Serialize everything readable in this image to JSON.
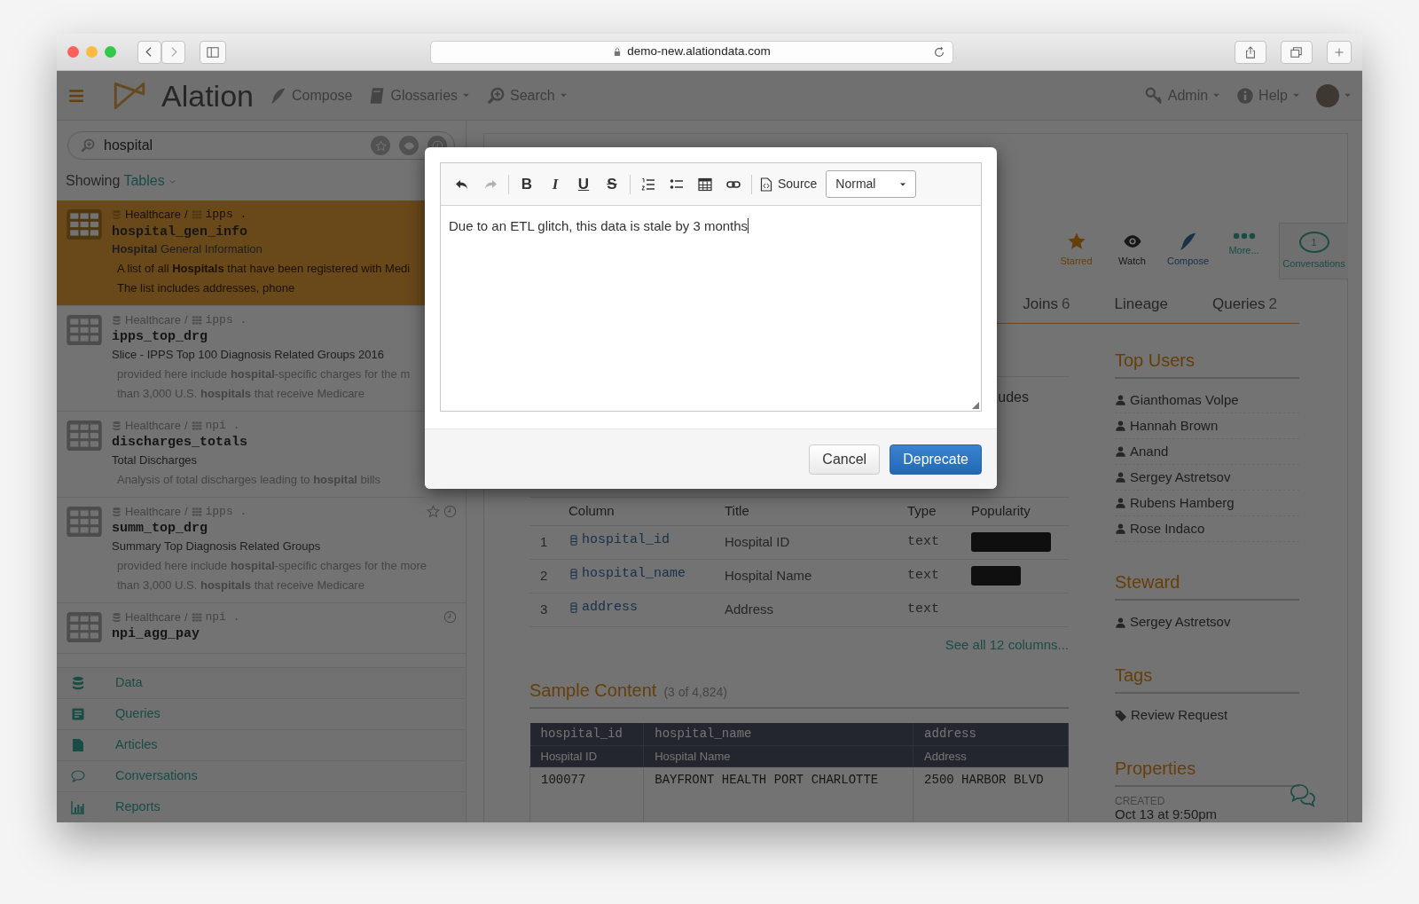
{
  "browser": {
    "url": "demo-new.alationdata.com"
  },
  "navbar": {
    "logo": "Alation",
    "items": [
      {
        "kind": "compose",
        "label": "Compose",
        "dropdown": false
      },
      {
        "kind": "glossaries",
        "label": "Glossaries",
        "dropdown": true
      },
      {
        "kind": "search",
        "label": "Search",
        "dropdown": true
      }
    ],
    "right_items": [
      {
        "kind": "admin",
        "label": "Admin",
        "dropdown": true
      },
      {
        "kind": "help",
        "label": "Help",
        "dropdown": true
      },
      {
        "kind": "avatar",
        "dropdown": true
      }
    ]
  },
  "sidebar": {
    "search": {
      "value": "hospital"
    },
    "filter_prefix": "Showing",
    "filter_value": "Tables",
    "results": [
      {
        "selected": true,
        "database": "Healthcare",
        "separator": "/",
        "schema": "ipps .",
        "name": "hospital_gen_info",
        "title": "**Hospital** General Information",
        "lines": [
          "A list of all **Hospitals** that have been registered with Medi",
          "The list includes addresses, phone"
        ],
        "star": false,
        "recent": false
      },
      {
        "selected": false,
        "database": "Healthcare",
        "separator": "/",
        "schema": "ipps .",
        "name": "ipps_top_drg",
        "title": "Slice - IPPS Top 100 Diagnosis Related Groups 2016",
        "lines": [
          "provided here include **hospital**-specific charges for the m",
          "than 3,000 U.S. **hospitals** that receive Medicare"
        ],
        "star": false,
        "recent": false
      },
      {
        "selected": false,
        "database": "Healthcare",
        "separator": "/",
        "schema": "npi .",
        "name": "discharges_totals",
        "title": "Total Discharges",
        "lines": [
          "Analysis of total discharges leading to **hospital** bills"
        ],
        "star": false,
        "recent": false
      },
      {
        "selected": false,
        "database": "Healthcare",
        "separator": "/",
        "schema": "ipps .",
        "name": "summ_top_drg",
        "title": "Summary Top Diagnosis Related Groups",
        "lines": [
          "provided here include **hospital**-specific charges for the more",
          "than 3,000 U.S. **hospitals** that receive Medicare"
        ],
        "star": true,
        "recent": true
      },
      {
        "selected": false,
        "database": "Healthcare",
        "separator": "/",
        "schema": "npi .",
        "name": "npi_agg_pay",
        "star": false,
        "recent": true
      }
    ],
    "nav": [
      {
        "kind": "data",
        "label": "Data"
      },
      {
        "kind": "queries",
        "label": "Queries"
      },
      {
        "kind": "articles",
        "label": "Articles"
      },
      {
        "kind": "conversations",
        "label": "Conversations"
      },
      {
        "kind": "reports",
        "label": "Reports"
      }
    ]
  },
  "actions": [
    {
      "kind": "star",
      "label": "Starred",
      "on": true
    },
    {
      "kind": "watch",
      "label": "Watch",
      "on": false
    },
    {
      "kind": "compose",
      "label": "Compose"
    },
    {
      "kind": "more",
      "label": "More..."
    }
  ],
  "conversations": {
    "label": "Conversations",
    "count": "1"
  },
  "tabs": [
    {
      "label": "Joins",
      "count": "6",
      "selected": false
    },
    {
      "label": "Lineage",
      "selected": false
    },
    {
      "label": "Queries",
      "count": "2",
      "selected": false
    }
  ],
  "description_tail": "udes",
  "columns_table": {
    "headers": [
      "Column",
      "Title",
      "Type",
      "Popularity"
    ],
    "rows": [
      {
        "number": "1",
        "name": "hospital_id",
        "title": "Hospital ID",
        "type": "text",
        "level": 0.82
      },
      {
        "number": "2",
        "name": "hospital_name",
        "title": "Hospital Name",
        "type": "text",
        "level": 0.51
      },
      {
        "number": "3",
        "name": "address",
        "title": "Address",
        "type": "text"
      }
    ],
    "see_all": "See all 12 columns..."
  },
  "sample": {
    "title": "Sample Content",
    "count": "(3 of 4,824)",
    "columns": [
      {
        "name": "hospital_id",
        "title": "Hospital ID"
      },
      {
        "name": "hospital_name",
        "title": "Hospital Name"
      },
      {
        "name": "address",
        "title": "Address"
      }
    ],
    "rows": [
      [
        "100077",
        "BAYFRONT HEALTH PORT CHARLOTTE",
        "2500 HARBOR BLVD"
      ]
    ]
  },
  "right_panel": {
    "sections": [
      {
        "title": "Top Users",
        "kind": "users",
        "items": [
          "Gianthomas Volpe",
          "Hannah Brown",
          "Anand",
          "Sergey Astretsov",
          "Rubens Hamberg",
          "Rose Indaco"
        ]
      },
      {
        "title": "Steward",
        "kind": "users",
        "items": [
          "Sergey Astretsov"
        ]
      },
      {
        "title": "Tags",
        "kind": "tags",
        "items": [
          "Review Request"
        ]
      },
      {
        "title": "Properties",
        "kind": "properties",
        "items": [
          {
            "label": "CREATED",
            "value": "Oct 13 at 9:50pm"
          }
        ]
      }
    ]
  },
  "modal": {
    "toolbar_groups": [
      [
        {
          "kind": "undo",
          "disabled": false
        },
        {
          "kind": "redo",
          "disabled": true
        }
      ],
      [
        {
          "kind": "bold",
          "label": "B",
          "disabled": false
        },
        {
          "kind": "italic",
          "label": "I",
          "disabled": false
        },
        {
          "kind": "underline",
          "label": "U",
          "disabled": false
        },
        {
          "kind": "strike",
          "label": "S",
          "disabled": false
        }
      ],
      [
        {
          "kind": "ordered-list",
          "disabled": false
        },
        {
          "kind": "bullet-list",
          "disabled": false
        },
        {
          "kind": "table",
          "disabled": false
        },
        {
          "kind": "link",
          "disabled": false
        }
      ],
      [
        {
          "kind": "source",
          "label": "Source",
          "disabled": false
        }
      ]
    ],
    "format": {
      "value": "Normal"
    },
    "text": "Due to an ETL glitch, this data is stale by 3 months",
    "buttons": [
      {
        "kind": "default",
        "label": "Cancel"
      },
      {
        "kind": "primary",
        "label": "Deprecate"
      }
    ]
  }
}
